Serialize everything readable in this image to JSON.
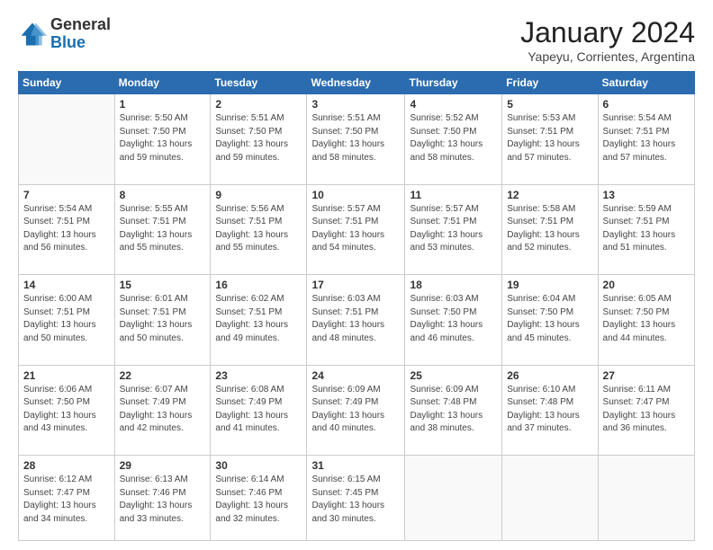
{
  "logo": {
    "general": "General",
    "blue": "Blue"
  },
  "header": {
    "month": "January 2024",
    "subtitle": "Yapeyu, Corrientes, Argentina"
  },
  "weekdays": [
    "Sunday",
    "Monday",
    "Tuesday",
    "Wednesday",
    "Thursday",
    "Friday",
    "Saturday"
  ],
  "days": [
    {
      "num": "",
      "sunrise": "",
      "sunset": "",
      "daylight": ""
    },
    {
      "num": "1",
      "sunrise": "Sunrise: 5:50 AM",
      "sunset": "Sunset: 7:50 PM",
      "daylight": "Daylight: 13 hours and 59 minutes."
    },
    {
      "num": "2",
      "sunrise": "Sunrise: 5:51 AM",
      "sunset": "Sunset: 7:50 PM",
      "daylight": "Daylight: 13 hours and 59 minutes."
    },
    {
      "num": "3",
      "sunrise": "Sunrise: 5:51 AM",
      "sunset": "Sunset: 7:50 PM",
      "daylight": "Daylight: 13 hours and 58 minutes."
    },
    {
      "num": "4",
      "sunrise": "Sunrise: 5:52 AM",
      "sunset": "Sunset: 7:50 PM",
      "daylight": "Daylight: 13 hours and 58 minutes."
    },
    {
      "num": "5",
      "sunrise": "Sunrise: 5:53 AM",
      "sunset": "Sunset: 7:51 PM",
      "daylight": "Daylight: 13 hours and 57 minutes."
    },
    {
      "num": "6",
      "sunrise": "Sunrise: 5:54 AM",
      "sunset": "Sunset: 7:51 PM",
      "daylight": "Daylight: 13 hours and 57 minutes."
    },
    {
      "num": "7",
      "sunrise": "Sunrise: 5:54 AM",
      "sunset": "Sunset: 7:51 PM",
      "daylight": "Daylight: 13 hours and 56 minutes."
    },
    {
      "num": "8",
      "sunrise": "Sunrise: 5:55 AM",
      "sunset": "Sunset: 7:51 PM",
      "daylight": "Daylight: 13 hours and 55 minutes."
    },
    {
      "num": "9",
      "sunrise": "Sunrise: 5:56 AM",
      "sunset": "Sunset: 7:51 PM",
      "daylight": "Daylight: 13 hours and 55 minutes."
    },
    {
      "num": "10",
      "sunrise": "Sunrise: 5:57 AM",
      "sunset": "Sunset: 7:51 PM",
      "daylight": "Daylight: 13 hours and 54 minutes."
    },
    {
      "num": "11",
      "sunrise": "Sunrise: 5:57 AM",
      "sunset": "Sunset: 7:51 PM",
      "daylight": "Daylight: 13 hours and 53 minutes."
    },
    {
      "num": "12",
      "sunrise": "Sunrise: 5:58 AM",
      "sunset": "Sunset: 7:51 PM",
      "daylight": "Daylight: 13 hours and 52 minutes."
    },
    {
      "num": "13",
      "sunrise": "Sunrise: 5:59 AM",
      "sunset": "Sunset: 7:51 PM",
      "daylight": "Daylight: 13 hours and 51 minutes."
    },
    {
      "num": "14",
      "sunrise": "Sunrise: 6:00 AM",
      "sunset": "Sunset: 7:51 PM",
      "daylight": "Daylight: 13 hours and 50 minutes."
    },
    {
      "num": "15",
      "sunrise": "Sunrise: 6:01 AM",
      "sunset": "Sunset: 7:51 PM",
      "daylight": "Daylight: 13 hours and 50 minutes."
    },
    {
      "num": "16",
      "sunrise": "Sunrise: 6:02 AM",
      "sunset": "Sunset: 7:51 PM",
      "daylight": "Daylight: 13 hours and 49 minutes."
    },
    {
      "num": "17",
      "sunrise": "Sunrise: 6:03 AM",
      "sunset": "Sunset: 7:51 PM",
      "daylight": "Daylight: 13 hours and 48 minutes."
    },
    {
      "num": "18",
      "sunrise": "Sunrise: 6:03 AM",
      "sunset": "Sunset: 7:50 PM",
      "daylight": "Daylight: 13 hours and 46 minutes."
    },
    {
      "num": "19",
      "sunrise": "Sunrise: 6:04 AM",
      "sunset": "Sunset: 7:50 PM",
      "daylight": "Daylight: 13 hours and 45 minutes."
    },
    {
      "num": "20",
      "sunrise": "Sunrise: 6:05 AM",
      "sunset": "Sunset: 7:50 PM",
      "daylight": "Daylight: 13 hours and 44 minutes."
    },
    {
      "num": "21",
      "sunrise": "Sunrise: 6:06 AM",
      "sunset": "Sunset: 7:50 PM",
      "daylight": "Daylight: 13 hours and 43 minutes."
    },
    {
      "num": "22",
      "sunrise": "Sunrise: 6:07 AM",
      "sunset": "Sunset: 7:49 PM",
      "daylight": "Daylight: 13 hours and 42 minutes."
    },
    {
      "num": "23",
      "sunrise": "Sunrise: 6:08 AM",
      "sunset": "Sunset: 7:49 PM",
      "daylight": "Daylight: 13 hours and 41 minutes."
    },
    {
      "num": "24",
      "sunrise": "Sunrise: 6:09 AM",
      "sunset": "Sunset: 7:49 PM",
      "daylight": "Daylight: 13 hours and 40 minutes."
    },
    {
      "num": "25",
      "sunrise": "Sunrise: 6:09 AM",
      "sunset": "Sunset: 7:48 PM",
      "daylight": "Daylight: 13 hours and 38 minutes."
    },
    {
      "num": "26",
      "sunrise": "Sunrise: 6:10 AM",
      "sunset": "Sunset: 7:48 PM",
      "daylight": "Daylight: 13 hours and 37 minutes."
    },
    {
      "num": "27",
      "sunrise": "Sunrise: 6:11 AM",
      "sunset": "Sunset: 7:47 PM",
      "daylight": "Daylight: 13 hours and 36 minutes."
    },
    {
      "num": "28",
      "sunrise": "Sunrise: 6:12 AM",
      "sunset": "Sunset: 7:47 PM",
      "daylight": "Daylight: 13 hours and 34 minutes."
    },
    {
      "num": "29",
      "sunrise": "Sunrise: 6:13 AM",
      "sunset": "Sunset: 7:46 PM",
      "daylight": "Daylight: 13 hours and 33 minutes."
    },
    {
      "num": "30",
      "sunrise": "Sunrise: 6:14 AM",
      "sunset": "Sunset: 7:46 PM",
      "daylight": "Daylight: 13 hours and 32 minutes."
    },
    {
      "num": "31",
      "sunrise": "Sunrise: 6:15 AM",
      "sunset": "Sunset: 7:45 PM",
      "daylight": "Daylight: 13 hours and 30 minutes."
    }
  ]
}
